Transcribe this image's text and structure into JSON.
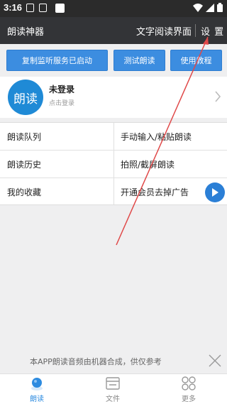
{
  "status_bar": {
    "time": "3:16"
  },
  "app_bar": {
    "title": "朗读神器",
    "reader_link": "文字阅读界面",
    "settings": "设 置"
  },
  "actions": {
    "monitor": "复制监听服务已启动",
    "test": "测试朗读",
    "tutorial": "使用教程"
  },
  "user": {
    "avatar_text": "朗读",
    "name": "未登录",
    "hint": "点击登录"
  },
  "menu": {
    "queue": "朗读队列",
    "manual_input": "手动输入/粘贴朗读",
    "history": "朗读历史",
    "photo": "拍照/截屏朗读",
    "favorites": "我的收藏",
    "vip": "开通会员去掉广告"
  },
  "notice": {
    "text": "本APP朗读音频由机器合成，供仅参考"
  },
  "tabs": [
    {
      "label": "朗读"
    },
    {
      "label": "文件"
    },
    {
      "label": "更多"
    }
  ],
  "colors": {
    "accent": "#3c8de0",
    "dark_bar": "#333437",
    "annotation": "#e04848"
  }
}
